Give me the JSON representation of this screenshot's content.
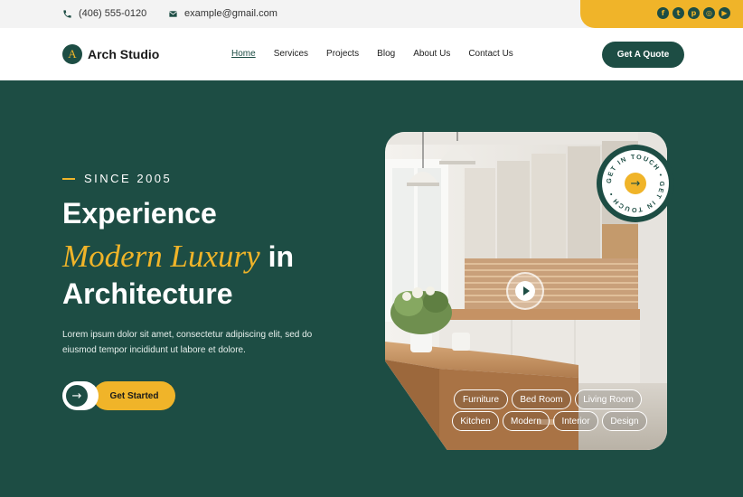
{
  "topbar": {
    "phone": "(406) 555-0120",
    "email": "example@gmail.com",
    "social": [
      {
        "icon": "facebook-icon",
        "glyph": "f"
      },
      {
        "icon": "twitter-icon",
        "glyph": "t"
      },
      {
        "icon": "pinterest-icon",
        "glyph": "p"
      },
      {
        "icon": "instagram-icon",
        "glyph": "◎"
      },
      {
        "icon": "youtube-icon",
        "glyph": "▶"
      }
    ]
  },
  "nav": {
    "logo_letter": "A",
    "logo_text": "Arch Studio",
    "links": [
      "Home",
      "Services",
      "Projects",
      "Blog",
      "About Us",
      "Contact Us"
    ],
    "active": "Home",
    "cta": "Get A Quote"
  },
  "hero": {
    "eyebrow": "SINCE 2005",
    "line1": "Experience",
    "line2_italic": "Modern Luxury",
    "line2_rest": " in",
    "line3": "Architecture",
    "description": "Lorem ipsum dolor sit amet, consectetur adipiscing elit, sed do eiusmod tempor incididunt ut labore et dolore.",
    "cta_label": "Get Started",
    "cta_arrow": "→"
  },
  "badge": {
    "ring_text": "GET IN TOUCH • GET IN TOUCH •",
    "arrow": "→"
  },
  "tags": [
    "Furniture",
    "Bed Room",
    "Living Room",
    "Kitchen",
    "Modern",
    "Interior",
    "Design"
  ],
  "colors": {
    "primary": "#1d4d44",
    "accent": "#f0b429"
  }
}
